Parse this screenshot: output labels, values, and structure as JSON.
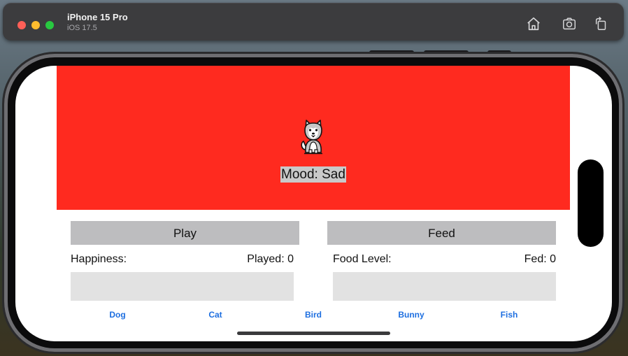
{
  "simulator": {
    "device_name": "iPhone 15 Pro",
    "os_version": "iOS 17.5",
    "icons": [
      "home-icon",
      "screenshot-icon",
      "rotate-icon"
    ]
  },
  "pet": {
    "icon": "dog-icon",
    "mood_text": "Mood: Sad",
    "panel_color": "#ff2a1f"
  },
  "actions": {
    "play_label": "Play",
    "feed_label": "Feed"
  },
  "stats": {
    "happiness_label": "Happiness:",
    "played_text": "Played: 0",
    "happiness_level": 0,
    "food_label": "Food Level:",
    "fed_text": "Fed: 0",
    "food_level": 0
  },
  "pet_tabs": [
    "Dog",
    "Cat",
    "Bird",
    "Bunny",
    "Fish"
  ],
  "colors": {
    "accent": "#1e6fe0",
    "button_bg": "#bdbdbf",
    "bar_bg": "#e2e2e2"
  }
}
